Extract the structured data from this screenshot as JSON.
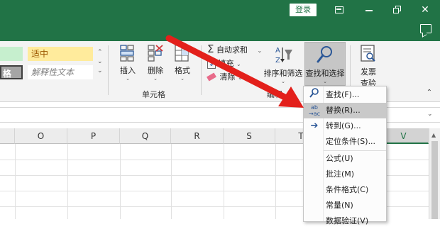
{
  "titlebar": {
    "login_label": "登录",
    "icons": [
      "ribbon-display-icon",
      "minimize-icon",
      "restore-icon",
      "comment-icon"
    ]
  },
  "ribbon": {
    "styles": {
      "good_label": "",
      "neutral_label": "适中",
      "check_label": "格",
      "explain_label": "解释性文本"
    },
    "cells_group": {
      "label": "单元格",
      "insert_label": "插入",
      "delete_label": "删除",
      "format_label": "格式"
    },
    "edit_group": {
      "label": "编辑",
      "autosum_label": "自动求和",
      "fill_label": "填充",
      "clear_label": "清除",
      "sort_label": "排序和筛选",
      "find_label": "查找和选择"
    },
    "invoice_group": {
      "label1": "发票",
      "label2": "查验"
    }
  },
  "grid": {
    "columns": [
      "O",
      "P",
      "Q",
      "R",
      "S",
      "T",
      "U",
      "V"
    ]
  },
  "menu": {
    "items": [
      {
        "label": "查找(F)...",
        "icon": "search-icon"
      },
      {
        "label": "替换(R)...",
        "icon": "replace-icon"
      },
      {
        "label": "转到(G)...",
        "icon": "goto-arrow-icon"
      },
      {
        "label": "定位条件(S)...",
        "icon": ""
      },
      {
        "label": "公式(U)",
        "icon": ""
      },
      {
        "label": "批注(M)",
        "icon": ""
      },
      {
        "label": "条件格式(C)",
        "icon": ""
      },
      {
        "label": "常量(N)",
        "icon": ""
      },
      {
        "label": "数据验证(V)",
        "icon": ""
      }
    ],
    "highlighted_index": 1
  },
  "colors": {
    "titlebar": "#217346",
    "highlight": "#c9c9c9",
    "arrow": "#e3201b",
    "active_column": "#217346"
  }
}
